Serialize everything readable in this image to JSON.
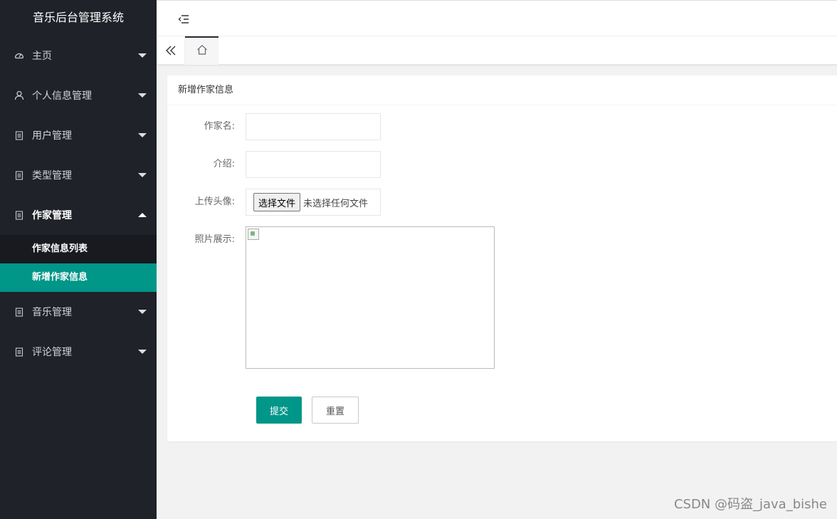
{
  "app": {
    "title": "音乐后台管理系统"
  },
  "sidebar": {
    "items": [
      {
        "label": "主页",
        "icon": "dashboard-icon",
        "open": false
      },
      {
        "label": "个人信息管理",
        "icon": "user-icon",
        "open": false
      },
      {
        "label": "用户管理",
        "icon": "document-icon",
        "open": false
      },
      {
        "label": "类型管理",
        "icon": "document-icon",
        "open": false
      },
      {
        "label": "作家管理",
        "icon": "document-icon",
        "open": true
      },
      {
        "label": "音乐管理",
        "icon": "document-icon",
        "open": false
      },
      {
        "label": "评论管理",
        "icon": "document-icon",
        "open": false
      }
    ],
    "submenu": [
      {
        "label": "作家信息列表",
        "active": false
      },
      {
        "label": "新增作家信息",
        "active": true
      }
    ]
  },
  "header": {
    "menu_toggle_icon": "menu-fold-icon"
  },
  "tabs": {
    "prev_icon": "double-chevron-left-icon",
    "home_icon": "home-icon"
  },
  "form": {
    "title": "新增作家信息",
    "fields": {
      "author_name": {
        "label": "作家名:",
        "value": ""
      },
      "intro": {
        "label": "介绍:",
        "value": ""
      },
      "avatar": {
        "label": "上传头像:",
        "button": "选择文件",
        "status": "未选择任何文件"
      },
      "photo": {
        "label": "照片展示:"
      }
    },
    "submit_label": "提交",
    "reset_label": "重置"
  },
  "watermark": "CSDN @码盗_java_bishe",
  "colors": {
    "sidebar_bg": "#20222a",
    "accent": "#009688",
    "submenu_bg": "#181a20"
  }
}
